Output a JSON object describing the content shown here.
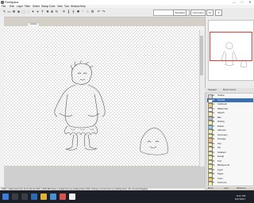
{
  "window": {
    "title": "FireAlpaca",
    "minimize": "—",
    "maximize": "□",
    "close": "✕"
  },
  "menu": [
    "File",
    "Edit",
    "Layer",
    "Filter",
    "Select",
    "Stamp",
    "Color",
    "View",
    "Tool",
    "Window",
    "Help"
  ],
  "toolbar": {
    "mode": "Standard",
    "field_a": "Correction",
    "field_b": "12",
    "field_c": "4"
  },
  "tab": {
    "label": "Untitled"
  },
  "panels": {
    "navigator": "Navigator",
    "history": "Brush Control"
  },
  "layers": [
    {
      "num": "14",
      "name": "Outline",
      "color": "#d9d9d9",
      "selected": false
    },
    {
      "num": "13",
      "name": "Pencil2",
      "color": "#ffffff",
      "selected": true
    },
    {
      "num": "12",
      "name": "Softbrush",
      "color": "#f2d16b",
      "selected": false
    },
    {
      "num": "11",
      "name": "Watercolor",
      "color": "#f5f5f5",
      "selected": false
    },
    {
      "num": "10",
      "name": "Sketch",
      "color": "#ffeeaa",
      "selected": false
    },
    {
      "num": "09",
      "name": "Blur",
      "color": "#c0c0c0",
      "selected": false
    },
    {
      "num": "08",
      "name": "Dotting",
      "color": "#f4f4a0",
      "selected": false
    },
    {
      "num": "07",
      "name": "Eraser",
      "color": "#8fd4f2",
      "selected": false
    },
    {
      "num": "06",
      "name": "Airbrush",
      "color": "#f4f4a0",
      "selected": false
    },
    {
      "num": "05",
      "name": "Symmetry",
      "color": "#f4f4a0",
      "selected": false
    },
    {
      "num": "04",
      "name": "Smudge",
      "color": "#ffc07a",
      "selected": false
    },
    {
      "num": "03",
      "name": "Pen",
      "color": "#f4f4a0",
      "selected": false
    },
    {
      "num": "02",
      "name": "Fill",
      "color": "#ffeeaa",
      "selected": false
    },
    {
      "num": "01",
      "name": "Gradient",
      "color": "#f4f4a0",
      "selected": false
    },
    {
      "num": "00",
      "name": "Rough",
      "color": "#f4f4a0",
      "selected": false
    },
    {
      "num": "22",
      "name": "Text",
      "color": "#f4f4a0",
      "selected": false
    },
    {
      "num": "23",
      "name": "Background",
      "color": "#f4f4a0",
      "selected": false
    },
    {
      "num": "24",
      "name": "Layer",
      "color": "#f4f4a0",
      "selected": false
    },
    {
      "num": "25",
      "name": "Paper",
      "color": "#f4f4a0",
      "selected": false
    },
    {
      "num": "26",
      "name": "Color",
      "color": "#ffd24a",
      "selected": false
    },
    {
      "num": "27",
      "name": "Fold Line",
      "color": "#f4f4a0",
      "selected": false
    }
  ],
  "panel_footer": {
    "left": "Brush",
    "mid": "Layer",
    "right": "Reference"
  },
  "status": "1662 * 1460 pixel   (0,0)   (0,0)   100 dpi   36%   1,855,380   Draw a straight line by holding down Shift. Change a brush size by holding down Ctrl, Alt and dragging.",
  "taskbar": {
    "time": "8:41 PM",
    "date": "6/27/2017"
  },
  "colors": {
    "accent": "#3b6fb0",
    "navigator_frame": "#e23b3b",
    "taskbar": "#1d1f26"
  }
}
